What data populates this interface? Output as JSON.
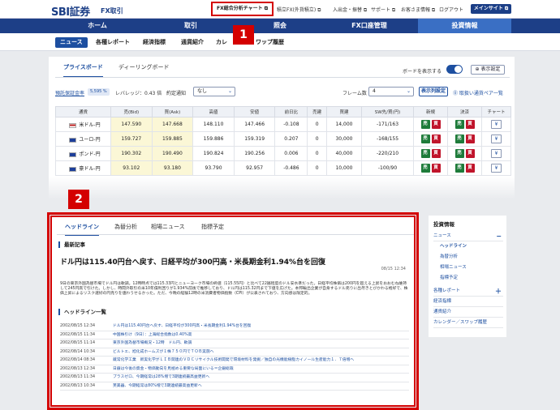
{
  "header": {
    "logo": "SBI証券",
    "logo_sub": "FX取引",
    "highlight_link": "FX総合分析チャート ⧉",
    "links": [
      "積立FX(外貨積立) ⧉",
      "入出金・振替 ⧉",
      "サポート ⧉",
      "お客さま情報 ⧉",
      "ログアウト"
    ],
    "mypage_button": "メインサイト ⧉"
  },
  "nav": {
    "items": [
      "ホーム",
      "取引",
      "照会",
      "FX口座管理",
      "投資情報"
    ],
    "active_index": 4
  },
  "subnav": {
    "items": [
      "ニュース",
      "各種レポート",
      "経済指標",
      "通貨紹介",
      "カレ",
      "ワップ履歴"
    ],
    "active_index": 0
  },
  "badges": {
    "b1": "1",
    "b2": "2"
  },
  "board": {
    "tabs": [
      "プライスボード",
      "ディーリングボード"
    ],
    "active_tab": 0,
    "show_board_label": "ボードを表示する",
    "show_setting_btn": "⊕ 表示設定",
    "margin_label": "預託保証金率",
    "margin_value": "5,595 %",
    "leverage_label": "レバレッジ：0.43 倍",
    "notice_label": "約定通知",
    "notice_value": "なし",
    "frame_label": "フレーム数",
    "frame_value": "4",
    "layout_btn": "表示列設定",
    "target_btn": "⓪ 取扱い通貨ペア一覧",
    "columns": [
      "通貨",
      "売(Bid)",
      "買(Ask)",
      "高値",
      "安値",
      "前日比",
      "売建",
      "買建",
      "SW先/買(円)",
      "新規",
      "決済",
      "チャート"
    ],
    "rows": [
      {
        "pair": "米ドル-円",
        "bid": "147.590",
        "ask": "147.668",
        "high": "148.110",
        "low": "147.466",
        "change": "-0.108",
        "sell": "0",
        "buy": "14,000",
        "sw": "-171/163"
      },
      {
        "pair": "ユーロ-円",
        "bid": "159.727",
        "ask": "159.885",
        "high": "159.886",
        "low": "159.319",
        "change": "0.207",
        "sell": "0",
        "buy": "30,000",
        "sw": "-168/155"
      },
      {
        "pair": "ポンド-円",
        "bid": "190.302",
        "ask": "190.490",
        "high": "190.824",
        "low": "190.256",
        "change": "0.006",
        "sell": "0",
        "buy": "40,000",
        "sw": "-220/210"
      },
      {
        "pair": "豪ドル-円",
        "bid": "93.102",
        "ask": "93.180",
        "high": "93.790",
        "low": "92.957",
        "change": "-0.486",
        "sell": "0",
        "buy": "10,000",
        "sw": "-100/90"
      }
    ],
    "sell_label": "売",
    "buy_label": "買",
    "chart_icon": "¥"
  },
  "news": {
    "tabs": [
      "ヘッドライン",
      "為替分析",
      "相場ニュース",
      "指標予定"
    ],
    "active_tab": 0,
    "latest_label": "最新記事",
    "headline": "ドル円は115.40円台へ戻す、日経平均が300円高・米長期金利1.94%台を回復",
    "date": "08/15 12:34",
    "body": "9日の東京外国為替市場でドル円は軟調。12時時点では115.33円とニューヨーク市場の終値（115.55円）と比べて22銭程度のドル安水準だった。日経平均株価は200円を超える上昇をおおむね維持して245円高で引けた。しかし、時間外取引の米10年債利回りが1.934%前後で推移しており、ドル円は115.32円まで下値を広げた。本邦輸出企業が自身するドル売りに出尽きとびかわる格好で、株価上昇によるリスク選好の円売りを値わうせるかった。ただ、今晩の経験12時の米消費者物価指数（CPI）が公表されており、方向感は限定的。",
    "list_label": "ヘッドライン一覧",
    "list": [
      {
        "date": "2002/08/15 12:34",
        "title": "ドル円は115.40円台へ戻す、日経平均が300円高・米長期金利1.94%台を回復"
      },
      {
        "date": "2002/08/15 11:34",
        "title": "中国株引け（9日）：上海総合指数は0.40%高"
      },
      {
        "date": "2002/08/15 11:14",
        "title": "東京外国為替市場概況・12時　ドル円、軟調"
      },
      {
        "date": "2002/08/14 10:34",
        "title": "ビルトエ、旭化成ホームズが１株７５０円でＴＯＢ実施へ"
      },
      {
        "date": "2002/08/14 08:34",
        "title": "蔵常化学工業　新実化学がＬＩＢ関連のＶＤＣリサイクル技術開発で環境材料を発掘／独自の光機能樹脂カイノール生産能力１．７倍増へ"
      },
      {
        "date": "2002/08/13 12:34",
        "title": "日銀は今後の資金・物価動向を見極める重要な局面にいる＝企銀総裁"
      },
      {
        "date": "2002/08/13 11:34",
        "title": "プラスゼロ、今期経常は28%増で3期連続最高益更新へ"
      },
      {
        "date": "2002/08/13 10:34",
        "title": "芙美器、今期経常は80%増で3期連続最高益更新へ"
      }
    ]
  },
  "sidebar": {
    "title": "投資情報",
    "items": [
      {
        "label": "ニュース",
        "level": 0,
        "mark": "−"
      },
      {
        "label": "ヘッドライン",
        "level": 1
      },
      {
        "label": "為替分析",
        "level": 1
      },
      {
        "label": "相場ニュース",
        "level": 1
      },
      {
        "label": "指標予定",
        "level": 1
      },
      {
        "label": "各種レポート",
        "level": 0,
        "mark": "＋"
      },
      {
        "label": "経済指標",
        "level": 0
      },
      {
        "label": "通貨紹介",
        "level": 0
      },
      {
        "label": "カレンダー／スワップ履歴",
        "level": 0
      }
    ]
  },
  "colors": {
    "brand": "#1d3f87",
    "highlight": "#d40000",
    "buy": "#1e7b3a",
    "sell": "#c0142b"
  }
}
